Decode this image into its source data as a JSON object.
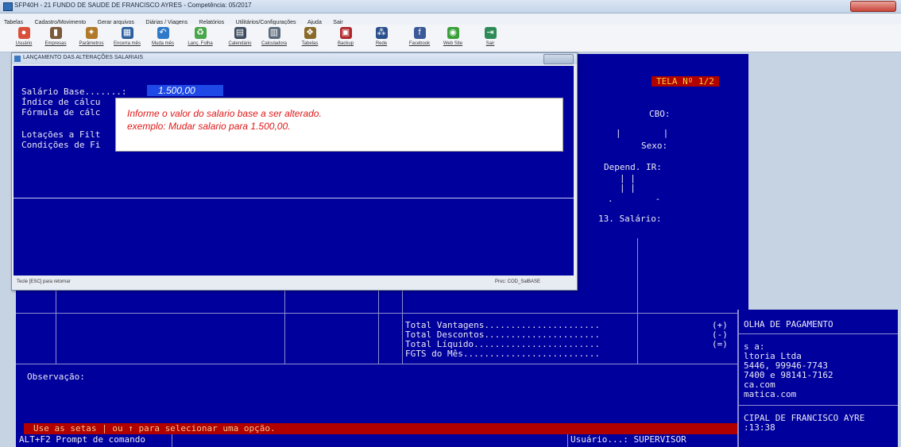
{
  "window": {
    "title": "SFP40H - 21 FUNDO DE SAUDE DE FRANCISCO AYRES  -  Competência: 05/2017"
  },
  "menu": [
    "Tabelas",
    "Cadastro/Movimento",
    "Gerar arquivos",
    "Diárias / Viagens",
    "Relatórios",
    "Utilitários/Configurações",
    "Ajuda",
    "Sair"
  ],
  "toolbar": [
    {
      "label": "Usuário",
      "icon": "users-icon",
      "color": "#d8503a",
      "glyph": "●"
    },
    {
      "label": "Empresas",
      "icon": "building-icon",
      "color": "#7a5a3a",
      "glyph": "▮"
    },
    {
      "label": "Parâmetros",
      "icon": "parameters-icon",
      "color": "#b07a2a",
      "glyph": "✦"
    },
    {
      "label": "Encerra mês",
      "icon": "close-month-icon",
      "color": "#2d5f9e",
      "glyph": "▦"
    },
    {
      "label": "Muda mês",
      "icon": "undo-icon",
      "color": "#2f79c8",
      "glyph": "↶"
    },
    {
      "label": "Lanç. Folha",
      "icon": "recycle-icon",
      "color": "#4aa64a",
      "glyph": "♻"
    },
    {
      "label": "Calendário",
      "icon": "calendar-icon",
      "color": "#3c4c5e",
      "glyph": "▤"
    },
    {
      "label": "Calculadora",
      "icon": "calculator-icon",
      "color": "#5a6a7a",
      "glyph": "▥"
    },
    {
      "label": "Tabelas",
      "icon": "tables-icon",
      "color": "#8a6a2a",
      "glyph": "❖"
    },
    {
      "label": "Backup",
      "icon": "save-icon",
      "color": "#b0262a",
      "glyph": "▣"
    },
    {
      "label": "Rede",
      "icon": "network-icon",
      "color": "#2a4f8c",
      "glyph": "⁂"
    },
    {
      "label": "Facebook",
      "icon": "facebook-icon",
      "color": "#3b5998",
      "glyph": "f"
    },
    {
      "label": "Web Site",
      "icon": "web-icon",
      "color": "#3aa03a",
      "glyph": "◉"
    },
    {
      "label": "Sair",
      "icon": "exit-icon",
      "color": "#2e8b57",
      "glyph": "⇥"
    }
  ],
  "dialog": {
    "title": "LANÇAMENTO DAS ALTERAÇÕES SALARIAIS",
    "salario_label": "Salário Base.......:",
    "salario_value": "1.500,00",
    "indice_label": "Índice de cálcu",
    "formula_label": "Fórmula de cálc",
    "lotacoes_label": "Lotações a Filt",
    "condicoes_label": "Condições de Fi",
    "status_left": "Tecle [ESC] para retornar",
    "status_right": "Proc: COD_SalBASE"
  },
  "tooltip": {
    "line1": "Informe o valor do salario base a ser alterado.",
    "line2": "exemplo: Mudar salario para 1.500,00."
  },
  "console": {
    "tela": "TELA Nº 1/2",
    "cbo": "CBO:",
    "sexo": "Sexo:",
    "depend": "Depend. IR:",
    "decimo": "13. Salário:",
    "vantagens": "Total Vantagens......................",
    "descontos": "Total Descontos......................",
    "liquido": "Total Líquido........................",
    "fgts": "FGTS do Mês..........................",
    "sign_plus": "(+)",
    "sign_minus": "(-)",
    "sign_eq": "(=)",
    "observacao": "Observação:",
    "status_bar": "Use as setas | ou ↑ para selecionar uma opção.",
    "alt_f2": "ALT+F2 Prompt de comando",
    "usuario": "Usuário...: SUPERVISOR"
  },
  "right_panel": {
    "title": "OLHA DE PAGAMENTO",
    "l1": "s a:",
    "l2": "ltoria Ltda",
    "l3": "5446, 99946-7743",
    "l4": "7400 e 98141-7162",
    "l5": "ca.com",
    "l6": "matica.com",
    "l7": "CIPAL DE FRANCISCO AYRE",
    "l8": ":13:38"
  },
  "colors": {
    "console_bg": "#00009c",
    "tela_bg": "#b00000",
    "tela_fg": "#f2d23a",
    "status_bg": "#b00000",
    "status_fg": "#f2c48a"
  }
}
